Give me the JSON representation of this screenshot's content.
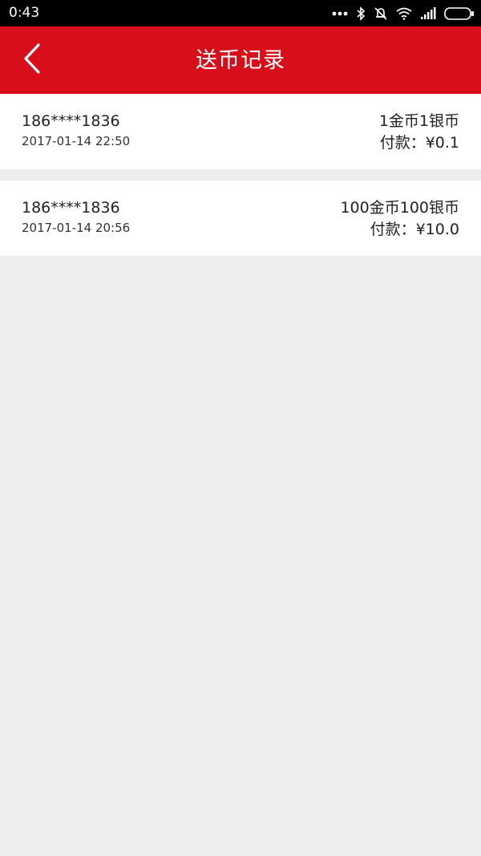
{
  "status_bar": {
    "time": "0:43",
    "icons": [
      "more-dots-icon",
      "bluetooth-icon",
      "mute-icon",
      "wifi-icon",
      "signal-icon",
      "battery-icon"
    ]
  },
  "header": {
    "title": "送币记录",
    "back_icon": "back-arrow-icon",
    "background_color": "#d80f1a"
  },
  "records": [
    {
      "phone": "186****1836",
      "time": "2017-01-14 22:50",
      "coins": "1金币1银币",
      "payment": "付款：¥0.1"
    },
    {
      "phone": "186****1836",
      "time": "2017-01-14 20:56",
      "coins": "100金币100银币",
      "payment": "付款：¥10.0"
    }
  ]
}
